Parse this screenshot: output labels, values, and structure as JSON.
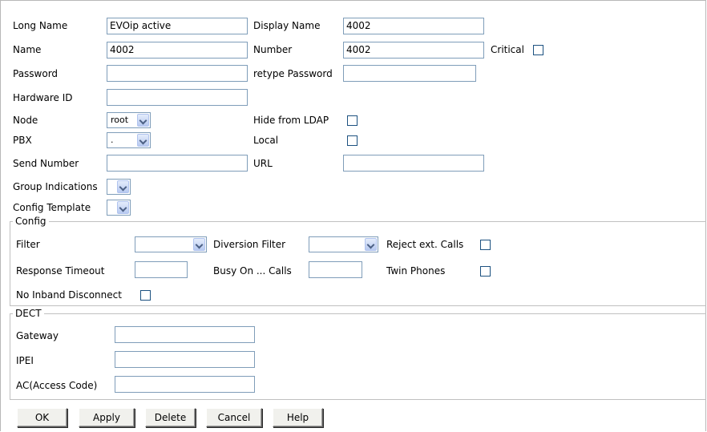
{
  "fields": {
    "long_name": {
      "label": "Long Name",
      "value": "EVOip active"
    },
    "display_name": {
      "label": "Display Name",
      "value": "4002"
    },
    "name": {
      "label": "Name",
      "value": "4002"
    },
    "number": {
      "label": "Number",
      "value": "4002"
    },
    "critical": {
      "label": "Critical",
      "checked": false
    },
    "password": {
      "label": "Password",
      "value": ""
    },
    "retype_password": {
      "label": "retype Password",
      "value": ""
    },
    "hardware_id": {
      "label": "Hardware ID",
      "value": ""
    },
    "node": {
      "label": "Node",
      "value": "root"
    },
    "hide_from_ldap": {
      "label": "Hide from LDAP",
      "checked": false
    },
    "pbx": {
      "label": "PBX",
      "value": "."
    },
    "local": {
      "label": "Local",
      "checked": false
    },
    "send_number": {
      "label": "Send Number",
      "value": ""
    },
    "url": {
      "label": "URL",
      "value": ""
    },
    "group_indications": {
      "label": "Group Indications",
      "value": ""
    },
    "config_template": {
      "label": "Config Template",
      "value": ""
    }
  },
  "config": {
    "legend": "Config",
    "filter": {
      "label": "Filter",
      "value": ""
    },
    "diversion_filter": {
      "label": "Diversion Filter",
      "value": ""
    },
    "reject_ext_calls": {
      "label": "Reject ext. Calls",
      "checked": false
    },
    "response_timeout": {
      "label": "Response Timeout",
      "value": ""
    },
    "busy_on_calls": {
      "label": "Busy On ... Calls",
      "value": ""
    },
    "twin_phones": {
      "label": "Twin Phones",
      "checked": false
    },
    "no_inband_disconnect": {
      "label": "No Inband Disconnect",
      "checked": false
    }
  },
  "dect": {
    "legend": "DECT",
    "gateway": {
      "label": "Gateway",
      "value": ""
    },
    "ipei": {
      "label": "IPEI",
      "value": ""
    },
    "access_code": {
      "label": "AC(Access Code)",
      "value": ""
    }
  },
  "buttons": {
    "ok": "OK",
    "apply": "Apply",
    "delete": "Delete",
    "cancel": "Cancel",
    "help": "Help"
  }
}
